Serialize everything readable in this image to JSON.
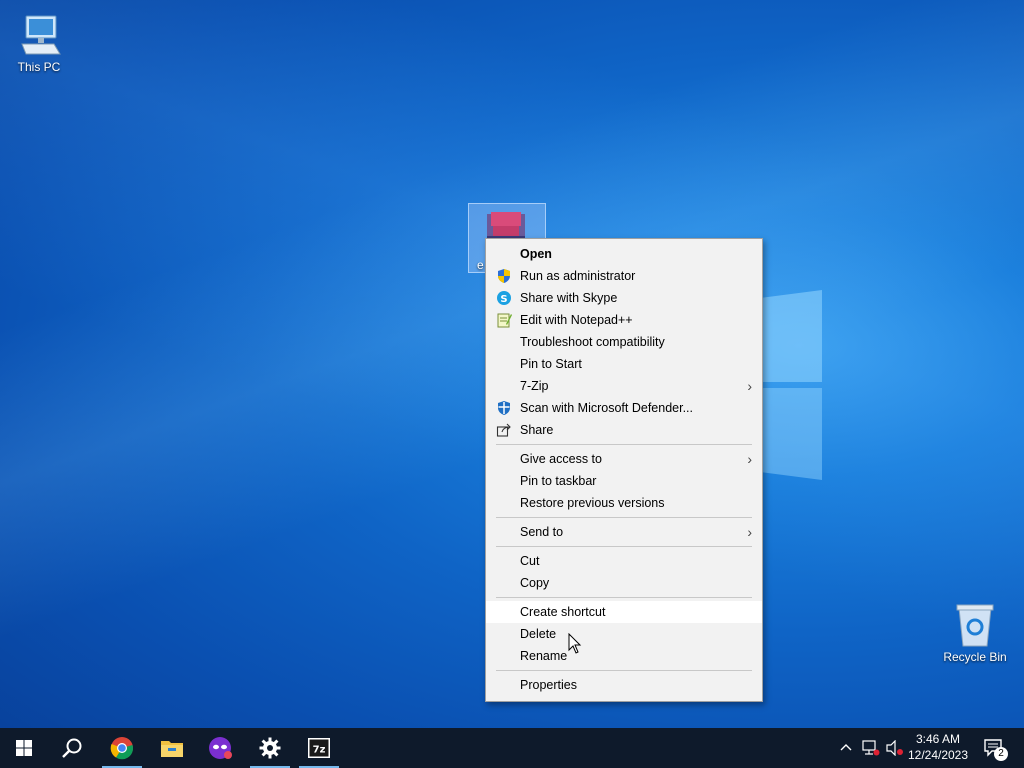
{
  "desktop": {
    "icons": [
      {
        "label": "This PC",
        "icon": "computer-icon"
      },
      {
        "label": "Recycle Bin",
        "icon": "recycle-bin-icon"
      }
    ],
    "selected_file": {
      "label_visible": "e",
      "icon": "file-icon"
    }
  },
  "context_menu": {
    "groups": [
      [
        {
          "label": "Open",
          "bold": true
        },
        {
          "label": "Run as administrator",
          "icon": "uac-shield-icon"
        },
        {
          "label": "Share with Skype",
          "icon": "skype-icon"
        },
        {
          "label": "Edit with Notepad++",
          "icon": "notepadpp-icon"
        },
        {
          "label": "Troubleshoot compatibility"
        },
        {
          "label": "Pin to Start"
        },
        {
          "label": "7-Zip",
          "submenu": true
        },
        {
          "label": "Scan with Microsoft Defender...",
          "icon": "defender-icon"
        },
        {
          "label": "Share",
          "icon": "share-icon"
        }
      ],
      [
        {
          "label": "Give access to",
          "submenu": true
        },
        {
          "label": "Pin to taskbar"
        },
        {
          "label": "Restore previous versions"
        }
      ],
      [
        {
          "label": "Send to",
          "submenu": true
        }
      ],
      [
        {
          "label": "Cut"
        },
        {
          "label": "Copy"
        }
      ],
      [
        {
          "label": "Create shortcut",
          "highlighted": true
        },
        {
          "label": "Delete"
        },
        {
          "label": "Rename"
        }
      ],
      [
        {
          "label": "Properties"
        }
      ]
    ],
    "submenu_arrow": "›"
  },
  "taskbar": {
    "buttons": [
      {
        "name": "start-button",
        "icon": "windows-logo-icon"
      },
      {
        "name": "search-button",
        "icon": "search-icon"
      },
      {
        "name": "chrome-button",
        "icon": "chrome-icon",
        "running": true
      },
      {
        "name": "file-explorer-button",
        "icon": "folder-icon"
      },
      {
        "name": "app-button",
        "icon": "mask-app-icon"
      },
      {
        "name": "settings-button",
        "icon": "gear-icon",
        "running": true
      },
      {
        "name": "7zip-button",
        "icon": "7zip-icon",
        "running": true
      }
    ],
    "tray": {
      "time": "3:46 AM",
      "date": "12/24/2023",
      "notification_count": "2"
    }
  },
  "colors": {
    "taskbar": "#0e1a2b",
    "menu_bg": "#f2f2f2",
    "highlight": "#ffffff",
    "running_indicator": "#76b9ed"
  }
}
